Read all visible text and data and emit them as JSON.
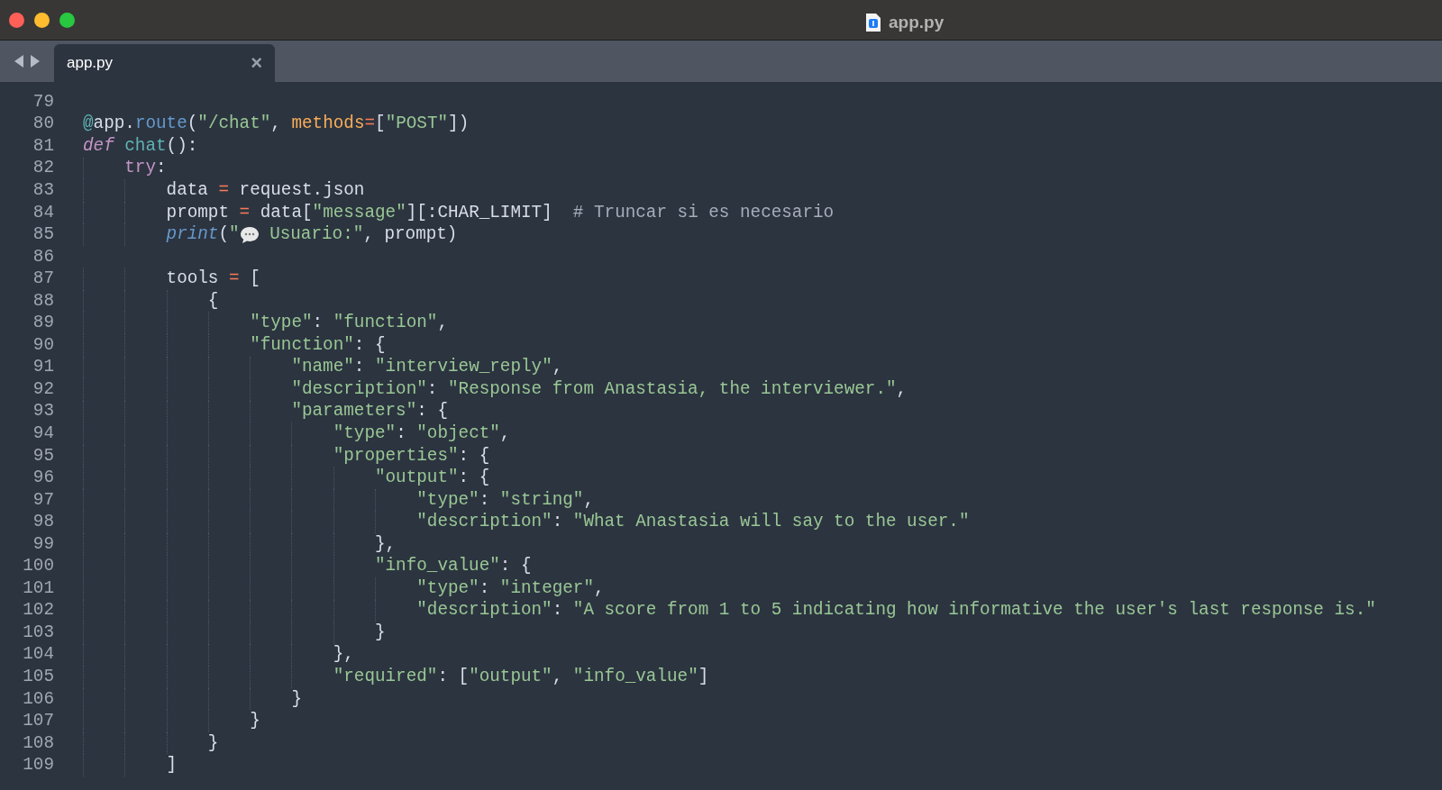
{
  "window": {
    "title": "app.py"
  },
  "tabs": [
    {
      "label": "app.py",
      "selected": true,
      "close": "×"
    }
  ],
  "editor": {
    "lines": [
      {
        "number": "79"
      },
      {
        "number": "80",
        "tokens": [
          {
            "t": "@",
            "kind": "fn"
          },
          {
            "t": "app",
            "kind": "plain"
          },
          {
            "t": ".",
            "kind": "plain"
          },
          {
            "t": "route",
            "kind": "method"
          },
          {
            "t": "(",
            "kind": "plain"
          },
          {
            "t": "\"/chat\"",
            "kind": "str"
          },
          {
            "t": ", ",
            "kind": "plain"
          },
          {
            "t": "methods",
            "kind": "param"
          },
          {
            "t": "=",
            "kind": "op"
          },
          {
            "t": "[",
            "kind": "plain"
          },
          {
            "t": "\"POST\"",
            "kind": "str"
          },
          {
            "t": "])",
            "kind": "plain"
          }
        ]
      },
      {
        "number": "81",
        "tokens": [
          {
            "t": "def",
            "kind": "kwi"
          },
          {
            "t": " chat",
            "kind": "fn"
          },
          {
            "t": "():",
            "kind": "plain"
          }
        ]
      },
      {
        "number": "82",
        "tokens": [
          {
            "t": "    try",
            "kind": "kw"
          },
          {
            "t": ":",
            "kind": "plain"
          }
        ]
      },
      {
        "number": "83",
        "tokens": [
          {
            "t": "        data ",
            "kind": "plain"
          },
          {
            "t": "=",
            "kind": "op"
          },
          {
            "t": " request.json",
            "kind": "plain"
          }
        ]
      },
      {
        "number": "84",
        "tokens": [
          {
            "t": "        prompt ",
            "kind": "plain"
          },
          {
            "t": "=",
            "kind": "op"
          },
          {
            "t": " data[",
            "kind": "plain"
          },
          {
            "t": "\"message\"",
            "kind": "str"
          },
          {
            "t": "][:CHAR_LIMIT]  ",
            "kind": "plain"
          },
          {
            "t": "# Truncar si es necesario",
            "kind": "comment"
          }
        ]
      },
      {
        "number": "85",
        "tokens": [
          {
            "t": "        print",
            "kind": "builtin"
          },
          {
            "t": "(",
            "kind": "plain"
          },
          {
            "t": "\"",
            "kind": "str"
          },
          {
            "kind": "speech_icon"
          },
          {
            "t": " Usuario:\"",
            "kind": "str"
          },
          {
            "t": ", prompt)",
            "kind": "plain"
          }
        ]
      },
      {
        "number": "86"
      },
      {
        "number": "87",
        "tokens": [
          {
            "t": "        tools ",
            "kind": "plain"
          },
          {
            "t": "=",
            "kind": "op"
          },
          {
            "t": " [",
            "kind": "plain"
          }
        ]
      },
      {
        "number": "88",
        "tokens": [
          {
            "t": "            {",
            "kind": "plain"
          }
        ]
      },
      {
        "number": "89",
        "tokens": [
          {
            "t": "                \"type\"",
            "kind": "str"
          },
          {
            "t": ": ",
            "kind": "plain"
          },
          {
            "t": "\"function\"",
            "kind": "str"
          },
          {
            "t": ",",
            "kind": "plain"
          }
        ]
      },
      {
        "number": "90",
        "tokens": [
          {
            "t": "                \"function\"",
            "kind": "str"
          },
          {
            "t": ": {",
            "kind": "plain"
          }
        ]
      },
      {
        "number": "91",
        "tokens": [
          {
            "t": "                    \"name\"",
            "kind": "str"
          },
          {
            "t": ": ",
            "kind": "plain"
          },
          {
            "t": "\"interview_reply\"",
            "kind": "str"
          },
          {
            "t": ",",
            "kind": "plain"
          }
        ]
      },
      {
        "number": "92",
        "tokens": [
          {
            "t": "                    \"description\"",
            "kind": "str"
          },
          {
            "t": ": ",
            "kind": "plain"
          },
          {
            "t": "\"Response from Anastasia, the interviewer.\"",
            "kind": "str"
          },
          {
            "t": ",",
            "kind": "plain"
          }
        ]
      },
      {
        "number": "93",
        "tokens": [
          {
            "t": "                    \"parameters\"",
            "kind": "str"
          },
          {
            "t": ": {",
            "kind": "plain"
          }
        ]
      },
      {
        "number": "94",
        "tokens": [
          {
            "t": "                        \"type\"",
            "kind": "str"
          },
          {
            "t": ": ",
            "kind": "plain"
          },
          {
            "t": "\"object\"",
            "kind": "str"
          },
          {
            "t": ",",
            "kind": "plain"
          }
        ]
      },
      {
        "number": "95",
        "tokens": [
          {
            "t": "                        \"properties\"",
            "kind": "str"
          },
          {
            "t": ": {",
            "kind": "plain"
          }
        ]
      },
      {
        "number": "96",
        "tokens": [
          {
            "t": "                            \"output\"",
            "kind": "str"
          },
          {
            "t": ": {",
            "kind": "plain"
          }
        ]
      },
      {
        "number": "97",
        "tokens": [
          {
            "t": "                                \"type\"",
            "kind": "str"
          },
          {
            "t": ": ",
            "kind": "plain"
          },
          {
            "t": "\"string\"",
            "kind": "str"
          },
          {
            "t": ",",
            "kind": "plain"
          }
        ]
      },
      {
        "number": "98",
        "tokens": [
          {
            "t": "                                \"description\"",
            "kind": "str"
          },
          {
            "t": ": ",
            "kind": "plain"
          },
          {
            "t": "\"What Anastasia will say to the user.\"",
            "kind": "str"
          }
        ]
      },
      {
        "number": "99",
        "tokens": [
          {
            "t": "                            },",
            "kind": "plain"
          }
        ]
      },
      {
        "number": "100",
        "tokens": [
          {
            "t": "                            \"info_value\"",
            "kind": "str"
          },
          {
            "t": ": {",
            "kind": "plain"
          }
        ]
      },
      {
        "number": "101",
        "tokens": [
          {
            "t": "                                \"type\"",
            "kind": "str"
          },
          {
            "t": ": ",
            "kind": "plain"
          },
          {
            "t": "\"integer\"",
            "kind": "str"
          },
          {
            "t": ",",
            "kind": "plain"
          }
        ]
      },
      {
        "number": "102",
        "tokens": [
          {
            "t": "                                \"description\"",
            "kind": "str"
          },
          {
            "t": ": ",
            "kind": "plain"
          },
          {
            "t": "\"A score from 1 to 5 indicating how informative the user's last response is.\"",
            "kind": "str"
          }
        ]
      },
      {
        "number": "103",
        "tokens": [
          {
            "t": "                            }",
            "kind": "plain"
          }
        ]
      },
      {
        "number": "104",
        "tokens": [
          {
            "t": "                        },",
            "kind": "plain"
          }
        ]
      },
      {
        "number": "105",
        "tokens": [
          {
            "t": "                        \"required\"",
            "kind": "str"
          },
          {
            "t": ": [",
            "kind": "plain"
          },
          {
            "t": "\"output\"",
            "kind": "str"
          },
          {
            "t": ", ",
            "kind": "plain"
          },
          {
            "t": "\"info_value\"",
            "kind": "str"
          },
          {
            "t": "]",
            "kind": "plain"
          }
        ]
      },
      {
        "number": "106",
        "tokens": [
          {
            "t": "                    }",
            "kind": "plain"
          }
        ]
      },
      {
        "number": "107",
        "tokens": [
          {
            "t": "                }",
            "kind": "plain"
          }
        ]
      },
      {
        "number": "108",
        "tokens": [
          {
            "t": "            }",
            "kind": "plain"
          }
        ]
      },
      {
        "number": "109",
        "tokens": [
          {
            "t": "        ]",
            "kind": "plain"
          }
        ]
      }
    ]
  }
}
